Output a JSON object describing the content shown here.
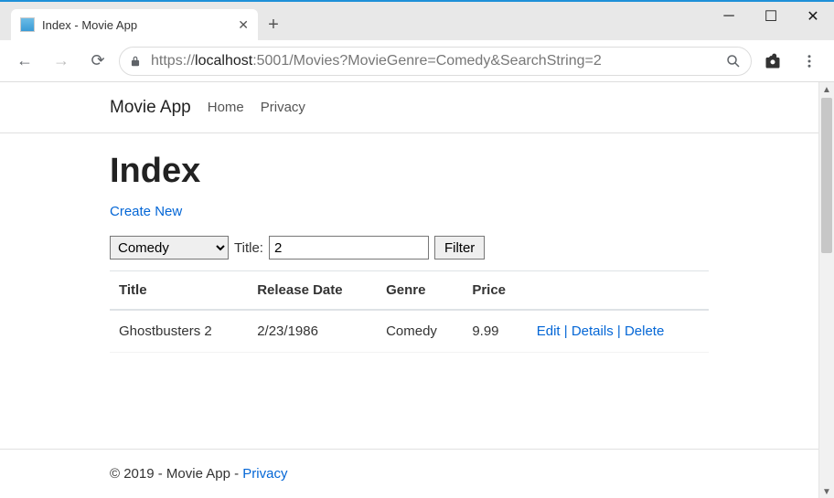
{
  "browser": {
    "tab_title": "Index - Movie App",
    "url_prefix": "https://",
    "url_host": "localhost",
    "url_rest": ":5001/Movies?MovieGenre=Comedy&SearchString=2"
  },
  "nav": {
    "brand": "Movie App",
    "home": "Home",
    "privacy": "Privacy"
  },
  "page": {
    "heading": "Index",
    "create_link": "Create New",
    "genre_selected": "Comedy",
    "title_label": "Title:",
    "title_value": "2",
    "filter_button": "Filter"
  },
  "table": {
    "headers": {
      "title": "Title",
      "release": "Release Date",
      "genre": "Genre",
      "price": "Price"
    },
    "rows": [
      {
        "title": "Ghostbusters 2",
        "release": "2/23/1986",
        "genre": "Comedy",
        "price": "9.99",
        "edit": "Edit",
        "details": "Details",
        "delete": "Delete",
        "sep": " | "
      }
    ]
  },
  "footer": {
    "copyright": "© 2019 - Movie App - ",
    "privacy": "Privacy"
  }
}
